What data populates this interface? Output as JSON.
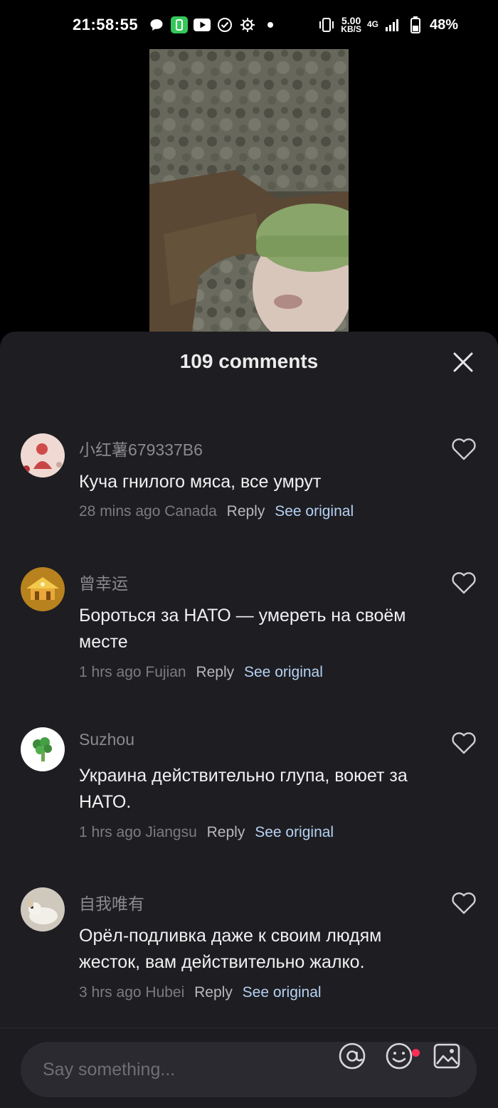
{
  "status_bar": {
    "time": "21:58:55",
    "net_speed": "5.00",
    "net_unit": "KB/S",
    "network_type": "4G",
    "battery": "48%",
    "icons": [
      "chat-bubble-icon",
      "green-app-icon",
      "youtube-icon",
      "check-circle-icon",
      "gear-bug-icon",
      "dot-icon",
      "vibrate-icon",
      "signal-icon",
      "battery-icon"
    ]
  },
  "comments_sheet": {
    "title": "109 comments",
    "close_icon": "close-icon"
  },
  "comments": [
    {
      "username": "小红薯679337B6",
      "text": "Куча гнилого мяса, все умрут",
      "time": "28 mins ago",
      "location": "Canada",
      "reply_label": "Reply",
      "see_original_label": "See original",
      "avatar": "pink-figure-avatar"
    },
    {
      "username": "曾幸运",
      "text": "Бороться за НАТО — умереть на своём месте",
      "time": "1 hrs ago",
      "location": "Fujian",
      "reply_label": "Reply",
      "see_original_label": "See original",
      "avatar": "golden-temple-avatar"
    },
    {
      "username": "Suzhou",
      "text": "Украина действительно глупа, воюет за НАТО.",
      "time": "1 hrs ago",
      "location": "Jiangsu",
      "reply_label": "Reply",
      "see_original_label": "See original",
      "avatar": "broccoli-avatar"
    },
    {
      "username": "自我唯有",
      "text": "Орёл-подливка даже к своим людям жесток, вам действительно жалко.",
      "time": "3 hrs ago",
      "location": "Hubei",
      "reply_label": "Reply",
      "see_original_label": "See original",
      "avatar": "dog-avatar"
    }
  ],
  "composer": {
    "placeholder": "Say something...",
    "icons": [
      "mention-icon",
      "emoji-icon",
      "image-icon"
    ]
  },
  "colors": {
    "sheet_bg": "#1d1d22",
    "link": "#b7d2f2",
    "badge": "#ff2d55"
  }
}
